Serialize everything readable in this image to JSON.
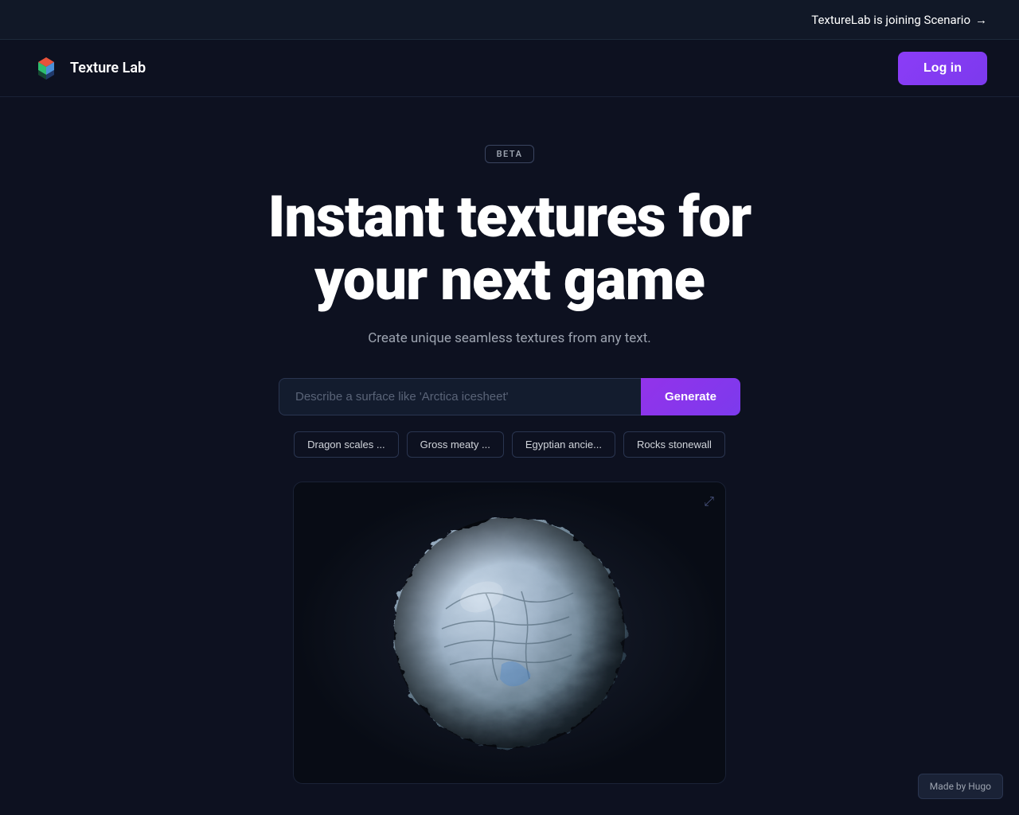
{
  "announcement": {
    "text": "TextureLab is joining Scenario",
    "arrow": "→"
  },
  "navbar": {
    "logo_text": "Texture Lab",
    "login_label": "Log in"
  },
  "hero": {
    "beta_label": "BETA",
    "title_line1": "Instant textures for",
    "title_line2": "your next game",
    "subtitle": "Create unique seamless textures from any text.",
    "input_placeholder": "Describe a surface like 'Arctica icesheet'",
    "generate_label": "Generate"
  },
  "suggestions": [
    {
      "label": "Dragon scales ..."
    },
    {
      "label": "Gross meaty ..."
    },
    {
      "label": "Egyptian ancie..."
    },
    {
      "label": "Rocks stonewall"
    }
  ],
  "preview": {
    "expand_icon": "⤢"
  },
  "footer": {
    "made_by": "Made by Hugo"
  }
}
